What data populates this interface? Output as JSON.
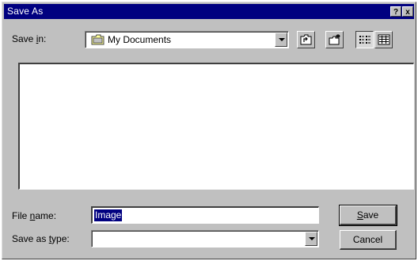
{
  "dialog": {
    "title": "Save As",
    "help_btn": "?",
    "close_btn": "x"
  },
  "save_in": {
    "label_pre": "Save ",
    "label_accel": "i",
    "label_post": "n:",
    "value": "My Documents"
  },
  "file_name": {
    "label_pre": "File ",
    "label_accel": "n",
    "label_post": "ame:",
    "value": "Image"
  },
  "save_as_type": {
    "label_pre": "Save as ",
    "label_accel": "t",
    "label_post": "ype:",
    "value": ""
  },
  "buttons": {
    "save_accel": "S",
    "save_rest": "ave",
    "cancel": "Cancel"
  },
  "toolbar_icons": [
    "up-one-level-icon",
    "create-new-folder-icon",
    "list-view-icon",
    "details-view-icon"
  ]
}
